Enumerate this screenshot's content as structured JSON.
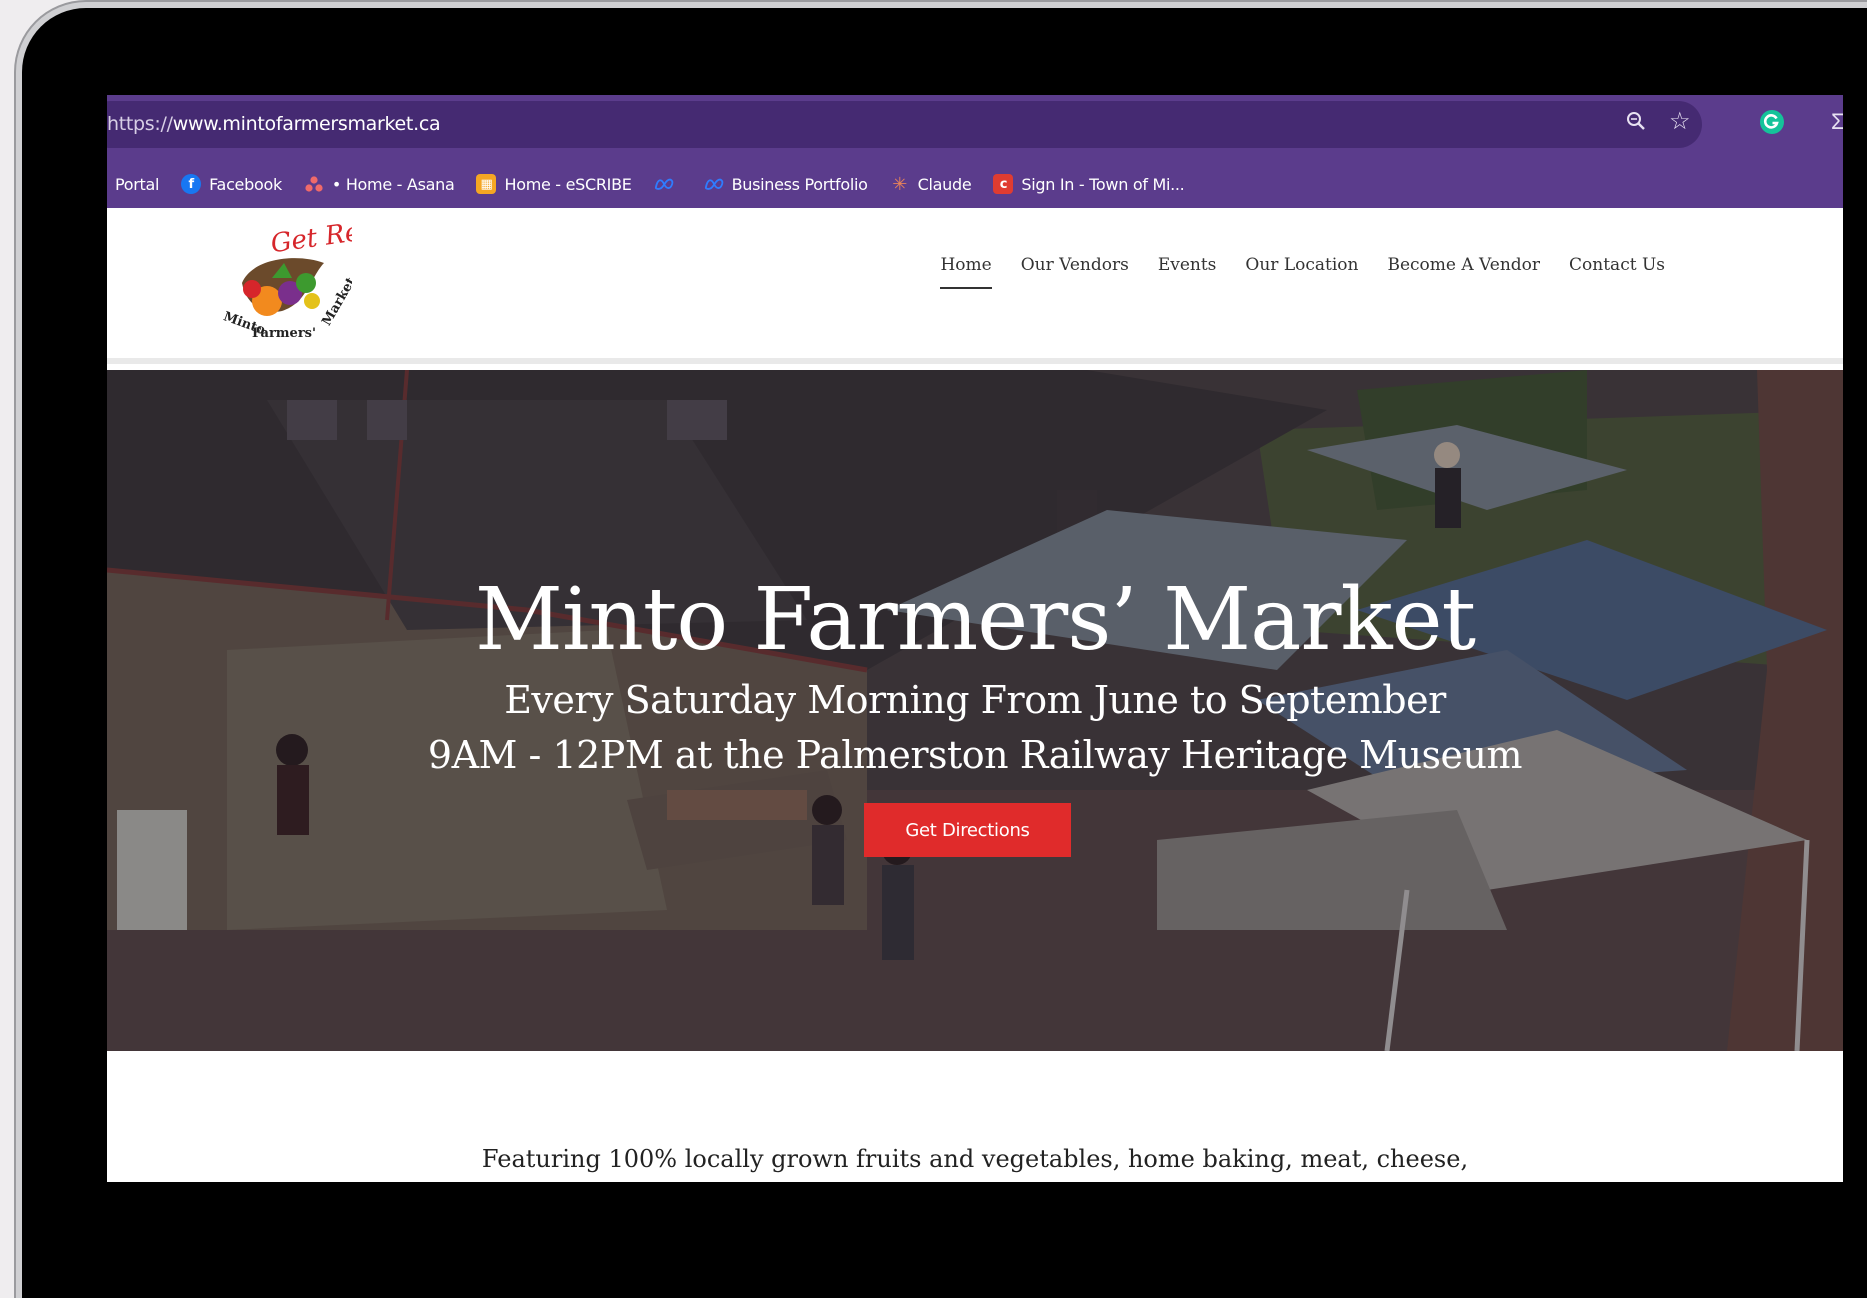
{
  "browser": {
    "url_prefix": "https://",
    "url_domain": "www.mintofarmersmarket.ca",
    "bookmarks": [
      {
        "label": "Portal"
      },
      {
        "label": "Facebook",
        "icon": "f",
        "color": "#1877f2"
      },
      {
        "label": "• Home - Asana",
        "icon": "asana-icon",
        "color": "#f06a6a"
      },
      {
        "label": "Home - eSCRIBE",
        "icon": "escribe-icon",
        "color": "#f5a623"
      },
      {
        "label": "",
        "icon": "meta-icon",
        "color": "#0a7cff"
      },
      {
        "label": "Business Portfolio",
        "icon": "meta-icon",
        "color": "#0a7cff"
      },
      {
        "label": "Claude",
        "icon": "claude-icon",
        "color": "#d97757"
      },
      {
        "label": "Sign In - Town of Mi...",
        "icon": "c",
        "color": "#e03c31"
      }
    ]
  },
  "site": {
    "logo": {
      "tagline": "Get Real!",
      "name": "Minto Farmers' Market"
    },
    "nav": [
      "Home",
      "Our Vendors",
      "Events",
      "Our Location",
      "Become A Vendor",
      "Contact Us"
    ],
    "active_nav": "Home"
  },
  "hero": {
    "title": "Minto Farmers’ Market",
    "line1": "Every Saturday Morning From June to September",
    "line2": "9AM - 12PM at the Palmerston Railway Heritage Museum",
    "cta": "Get Directions"
  },
  "intro": {
    "text": "Featuring 100% locally grown fruits and vegetables, home baking, meat, cheese,"
  },
  "colors": {
    "chrome": "#5b3c8c",
    "cta": "#e02b2b"
  }
}
